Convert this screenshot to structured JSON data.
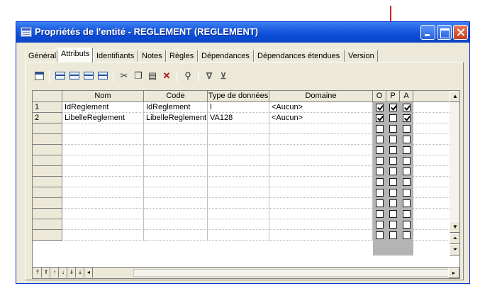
{
  "window": {
    "title": "Propriétés de l'entité - REGLEMENT (REGLEMENT)",
    "accent": "#0a4bd5",
    "close_color": "#c63d1a"
  },
  "tabs": [
    {
      "label": "Général",
      "active": false
    },
    {
      "label": "Attributs",
      "active": true
    },
    {
      "label": "Identifiants",
      "active": false
    },
    {
      "label": "Notes",
      "active": false
    },
    {
      "label": "Règles",
      "active": false
    },
    {
      "label": "Dépendances",
      "active": false
    },
    {
      "label": "Dépendances étendues",
      "active": false
    },
    {
      "label": "Version",
      "active": false
    }
  ],
  "toolbar": {
    "icons": [
      "properties-icon",
      "add-row-icon",
      "insert-row-icon",
      "add-columns-icon",
      "copy-rows-icon",
      "cut-icon",
      "copy-icon",
      "paste-icon",
      "delete-icon",
      "find-icon",
      "filter-icon",
      "filter-clear-icon"
    ]
  },
  "grid": {
    "columns": [
      "Nom",
      "Code",
      "Type de données",
      "Domaine",
      "O",
      "P",
      "A"
    ],
    "rows": [
      {
        "num": "1",
        "nom": "IdReglement",
        "code": "IdReglement",
        "type": "I",
        "domaine": "<Aucun>",
        "o": true,
        "p": true,
        "a": true
      },
      {
        "num": "2",
        "nom": "LibelleReglement",
        "code": "LibelleReglement",
        "type": "VA128",
        "domaine": "<Aucun>",
        "o": true,
        "p": false,
        "a": true
      }
    ],
    "empty_rows": 11
  },
  "nav": {
    "icons": [
      "first-icon",
      "page-up-icon",
      "up-icon",
      "down-icon",
      "page-down-icon",
      "last-icon",
      "scroll-left-icon"
    ]
  },
  "annotation": {
    "color": "#e0201b"
  }
}
